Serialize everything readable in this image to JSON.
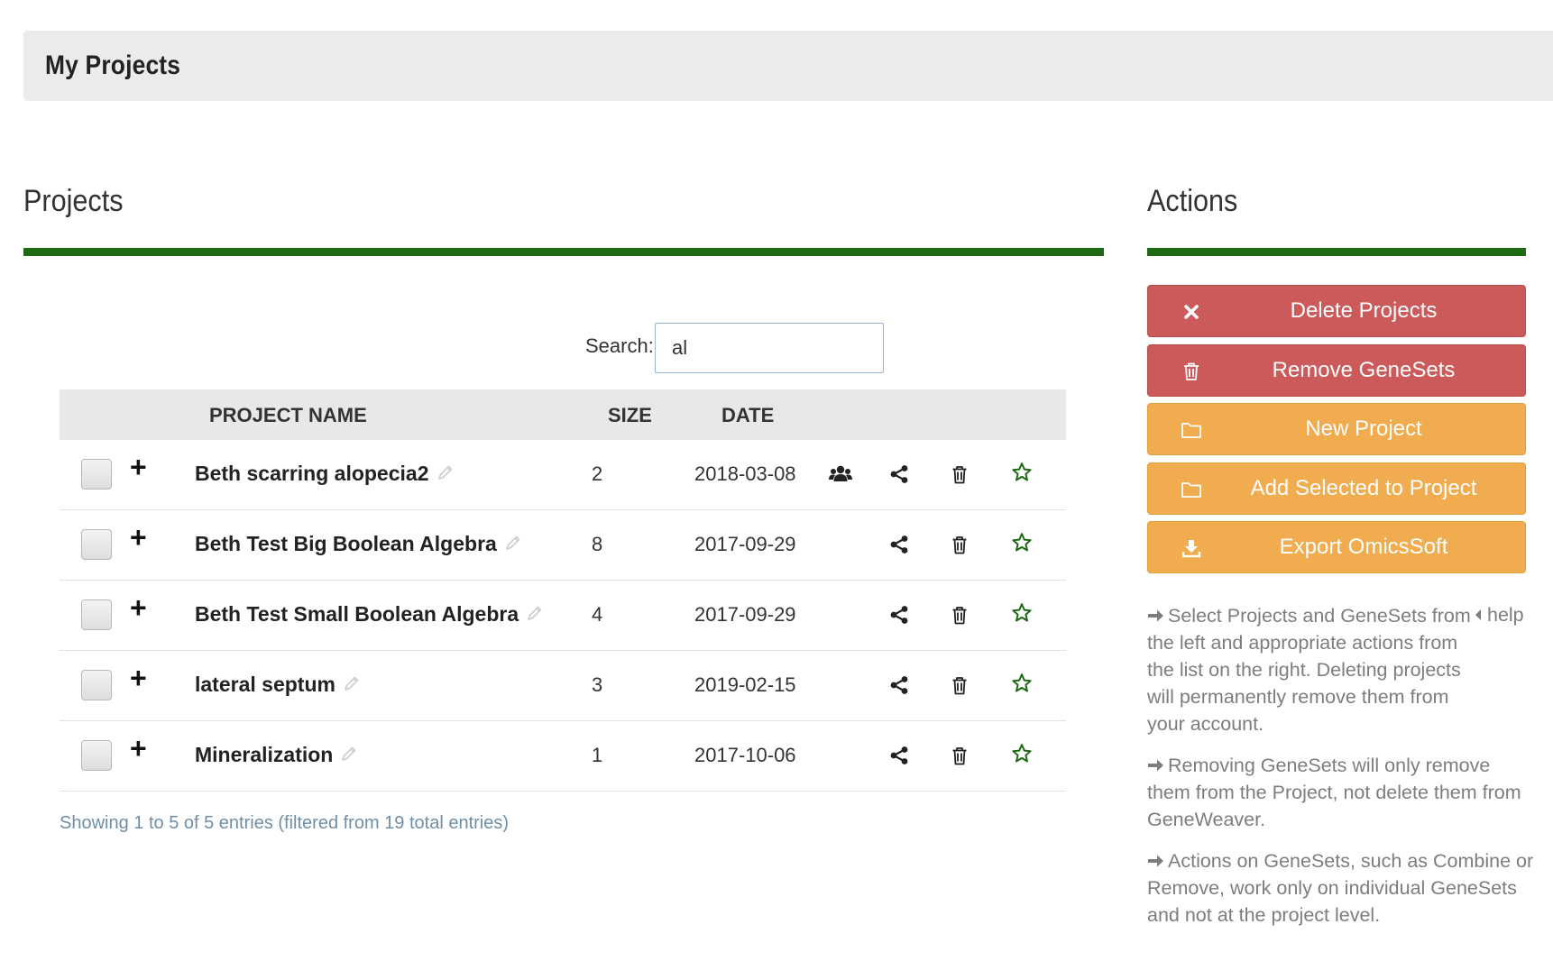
{
  "header": {
    "title": "My Projects"
  },
  "projects_section": {
    "title": "Projects"
  },
  "actions_section": {
    "title": "Actions"
  },
  "search": {
    "label": "Search:",
    "value": "al"
  },
  "table": {
    "columns": {
      "name": "PROJECT NAME",
      "size": "SIZE",
      "date": "DATE"
    },
    "rows": [
      {
        "name": "Beth scarring alopecia2",
        "size": "2",
        "date": "2018-03-08",
        "shared_group": true
      },
      {
        "name": "Beth Test Big Boolean Algebra",
        "size": "8",
        "date": "2017-09-29",
        "shared_group": false
      },
      {
        "name": "Beth Test Small Boolean Algebra",
        "size": "4",
        "date": "2017-09-29",
        "shared_group": false
      },
      {
        "name": "lateral septum",
        "size": "3",
        "date": "2019-02-15",
        "shared_group": false
      },
      {
        "name": "Mineralization",
        "size": "1",
        "date": "2017-10-06",
        "shared_group": false
      }
    ],
    "info": "Showing 1 to 5 of 5 entries (filtered from 19 total entries)"
  },
  "actions": {
    "delete_projects": "Delete Projects",
    "remove_genesets": "Remove GeneSets",
    "new_project": "New Project",
    "add_selected": "Add Selected to Project",
    "export_omicssoft": "Export OmicsSoft"
  },
  "help": {
    "link": "help",
    "p1": "Select Projects and GeneSets from the left and appropriate actions from the list on the right. Deleting projects will permanently remove them from your account.",
    "p2": "Removing GeneSets will only remove them from the Project, not delete them from GeneWeaver.",
    "p3": "Actions on GeneSets, such as Combine or Remove, work only on individual GeneSets and not at the project level."
  },
  "colors": {
    "accent_green": "#1e6a14",
    "danger_red": "#cc5a5a",
    "warning_orange": "#f0ac4e",
    "star_green": "#1e6a14"
  },
  "icons": {
    "row_actions": [
      "group-icon",
      "share-icon",
      "trash-icon",
      "star-icon"
    ],
    "buttons": [
      "times-icon",
      "trash-icon",
      "folder-icon",
      "folder-icon",
      "download-icon"
    ]
  }
}
